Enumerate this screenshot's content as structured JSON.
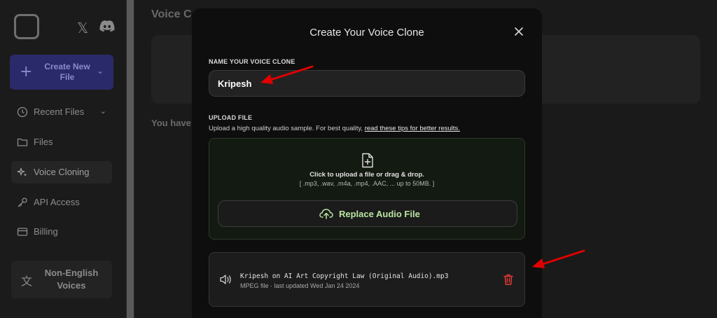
{
  "sidebar": {
    "create_label": "Create New File",
    "items": [
      {
        "label": "Recent Files",
        "icon": "clock-icon"
      },
      {
        "label": "Files",
        "icon": "folder-icon"
      },
      {
        "label": "Voice Cloning",
        "icon": "sparkle-icon"
      },
      {
        "label": "API Access",
        "icon": "key-icon"
      },
      {
        "label": "Billing",
        "icon": "card-icon"
      }
    ],
    "language_card": "Non-English Voices"
  },
  "main": {
    "title": "Voice C",
    "note": "You have"
  },
  "modal": {
    "title": "Create Your Voice Clone",
    "name_label": "NAME YOUR VOICE CLONE",
    "name_value": "Kripesh",
    "upload_label": "UPLOAD FILE",
    "upload_help_prefix": "Upload a high quality audio sample. For best quality,",
    "upload_help_link": "read these tips for better results.",
    "dropzone_main": "Click to upload a file or drag & drop.",
    "dropzone_sub": "[ .mp3, .wav, .m4a, .mp4, .AAC, ... up to 50MB. ]",
    "replace_label": "Replace Audio File",
    "file": {
      "name": "Kripesh on AI Art Copyright Law (Original Audio).mp3",
      "meta": "MPEG file · last updated Wed Jan 24 2024"
    }
  },
  "colors": {
    "accent_green": "#b8e6a0",
    "trash_red": "#e53935",
    "arrow_red": "#e00000",
    "create_button": "#2a2a6a"
  }
}
